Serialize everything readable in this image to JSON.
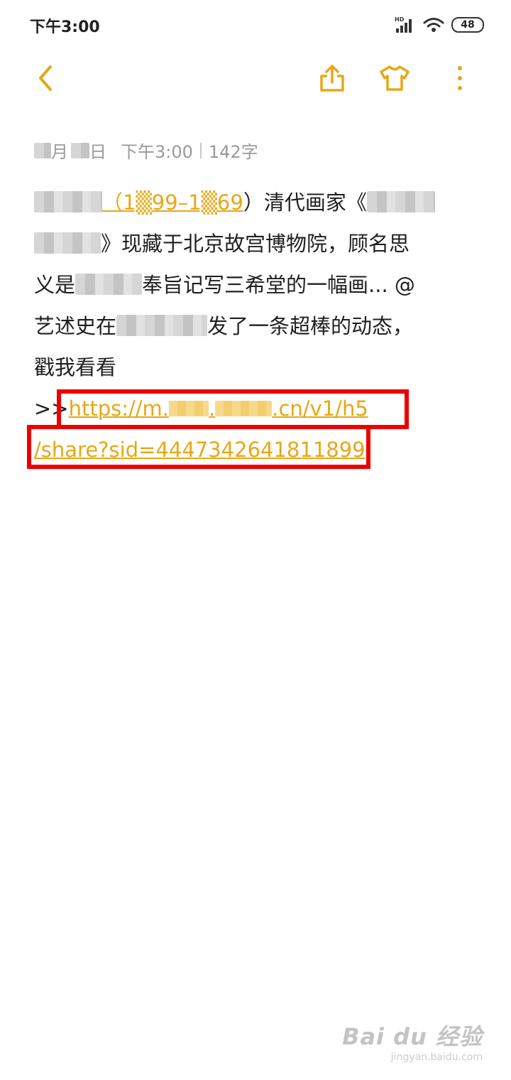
{
  "status_bar": {
    "time": "下午3:00",
    "battery": "48",
    "icons": [
      "hd-signal-icon",
      "wifi-icon",
      "battery-icon"
    ]
  },
  "toolbar": {
    "back_icon": "chevron-left-icon",
    "share_icon": "share-icon",
    "theme_icon": "tshirt-icon",
    "more_icon": "more-vertical-icon",
    "accent_color": "#e6a817"
  },
  "meta": {
    "month_suffix": "月",
    "day_suffix": "日",
    "time": "下午3:00",
    "word_count": "142字"
  },
  "note": {
    "years_link": "（1▒99–1▒69",
    "l1_after": "）清代画家《",
    "l2_after": "》现藏于北京故宫博物院，顾名思",
    "l3_before": "义是",
    "l3_after": "奉旨记写三希堂的一幅画... @",
    "l4_before": "艺述史在",
    "l4_after": "发了一条超棒的动态，",
    "l5": "戳我看看",
    "link_prefix": ">>",
    "url_part1": "https://m.",
    "url_dot": ".",
    "url_part2": ".cn/v1/h5",
    "url_line2": "/share?sid=4447342641811899"
  },
  "highlight_color": "#ee0000",
  "watermark": {
    "brand": "Bai du 经验",
    "url": "jingyan.baidu.com"
  }
}
